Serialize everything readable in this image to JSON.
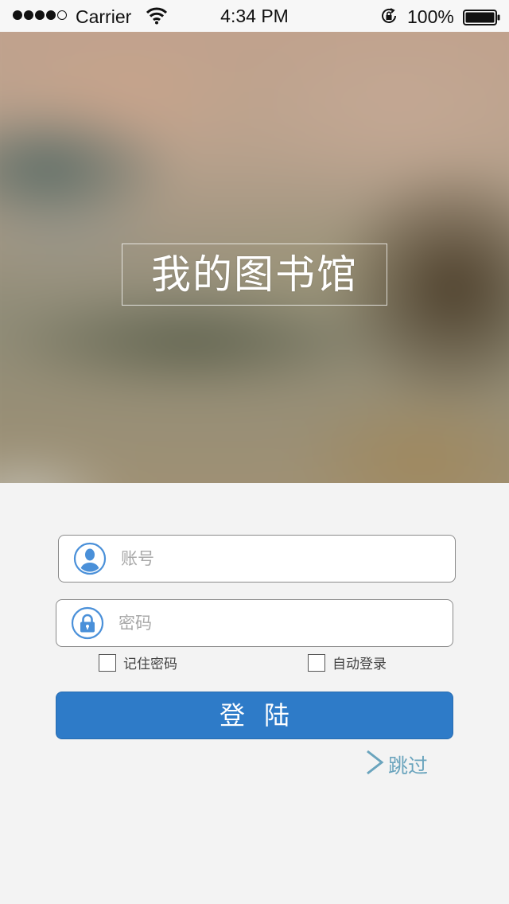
{
  "status_bar": {
    "carrier": "Carrier",
    "time": "4:34 PM",
    "battery_percent": "100%",
    "signal_bars_filled": 4,
    "signal_bars_total": 5,
    "icons": [
      "wifi-icon",
      "rotation-lock-icon",
      "battery-icon"
    ]
  },
  "hero": {
    "title": "我的图书馆"
  },
  "form": {
    "account": {
      "placeholder": "账号",
      "value": "",
      "icon": "user-icon",
      "icon_color": "#4a90d9"
    },
    "password": {
      "placeholder": "密码",
      "value": "",
      "icon": "lock-icon",
      "icon_color": "#4a90d9"
    },
    "remember_password": {
      "label": "记住密码",
      "checked": false
    },
    "auto_login": {
      "label": "自动登录",
      "checked": false
    },
    "login_button": {
      "label": "登陆",
      "color": "#2e7bc8"
    },
    "skip": {
      "label": "跳过",
      "icon": "chevron-right-icon",
      "color": "#6aa4bd"
    }
  }
}
